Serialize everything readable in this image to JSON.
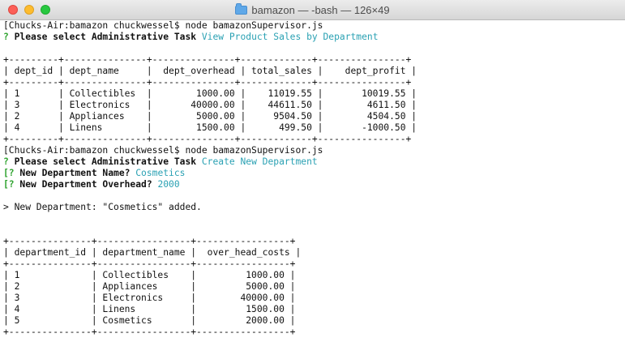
{
  "window": {
    "title": "bamazon — -bash — 126×49"
  },
  "terminal": {
    "colors": {
      "prompt_mark": "#2fa32f",
      "answer": "#2aa1b3",
      "text": "#111111"
    },
    "lines": [
      {
        "segments": [
          {
            "text": "[Chucks-Air:bamazon chuckwessel$ node bamazonSupervisor.js",
            "style": ""
          }
        ]
      },
      {
        "segments": [
          {
            "text": "? ",
            "style": "green bold"
          },
          {
            "text": "Please select Administrative Task ",
            "style": "bold"
          },
          {
            "text": "View Product Sales by Department",
            "style": "cyan"
          }
        ]
      },
      {
        "segments": []
      },
      {
        "segments": [
          {
            "text": "+---------+---------------+---------------+-------------+----------------+",
            "style": ""
          }
        ]
      },
      {
        "segments": [
          {
            "text": "| dept_id | dept_name     |  dept_overhead | total_sales |    dept_profit |",
            "style": ""
          }
        ]
      },
      {
        "segments": [
          {
            "text": "+---------+---------------+---------------+-------------+----------------+",
            "style": ""
          }
        ]
      },
      {
        "segments": [
          {
            "text": "| 1       | Collectibles  |        1000.00 |    11019.55 |       10019.55 |",
            "style": ""
          }
        ]
      },
      {
        "segments": [
          {
            "text": "| 3       | Electronics   |       40000.00 |    44611.50 |        4611.50 |",
            "style": ""
          }
        ]
      },
      {
        "segments": [
          {
            "text": "| 2       | Appliances    |        5000.00 |     9504.50 |        4504.50 |",
            "style": ""
          }
        ]
      },
      {
        "segments": [
          {
            "text": "| 4       | Linens        |        1500.00 |      499.50 |       -1000.50 |",
            "style": ""
          }
        ]
      },
      {
        "segments": [
          {
            "text": "+---------+---------------+---------------+-------------+----------------+",
            "style": ""
          }
        ]
      },
      {
        "segments": [
          {
            "text": "[Chucks-Air:bamazon chuckwessel$ node bamazonSupervisor.js",
            "style": ""
          }
        ]
      },
      {
        "segments": [
          {
            "text": "? ",
            "style": "green bold"
          },
          {
            "text": "Please select Administrative Task ",
            "style": "bold"
          },
          {
            "text": "Create New Department",
            "style": "cyan"
          }
        ]
      },
      {
        "segments": [
          {
            "text": "[? ",
            "style": "green bold"
          },
          {
            "text": "New Department Name? ",
            "style": "bold"
          },
          {
            "text": "Cosmetics",
            "style": "cyan"
          }
        ]
      },
      {
        "segments": [
          {
            "text": "[? ",
            "style": "green bold"
          },
          {
            "text": "New Department Overhead? ",
            "style": "bold"
          },
          {
            "text": "2000",
            "style": "cyan"
          }
        ]
      },
      {
        "segments": []
      },
      {
        "segments": [
          {
            "text": "> New Department: \"Cosmetics\" added.",
            "style": ""
          }
        ]
      },
      {
        "segments": []
      },
      {
        "segments": []
      },
      {
        "segments": [
          {
            "text": "+---------------+-----------------+-----------------+",
            "style": ""
          }
        ]
      },
      {
        "segments": [
          {
            "text": "| department_id | department_name |  over_head_costs |",
            "style": ""
          }
        ]
      },
      {
        "segments": [
          {
            "text": "+---------------+-----------------+-----------------+",
            "style": ""
          }
        ]
      },
      {
        "segments": [
          {
            "text": "| 1             | Collectibles    |         1000.00 |",
            "style": ""
          }
        ]
      },
      {
        "segments": [
          {
            "text": "| 2             | Appliances      |         5000.00 |",
            "style": ""
          }
        ]
      },
      {
        "segments": [
          {
            "text": "| 3             | Electronics     |        40000.00 |",
            "style": ""
          }
        ]
      },
      {
        "segments": [
          {
            "text": "| 4             | Linens          |         1500.00 |",
            "style": ""
          }
        ]
      },
      {
        "segments": [
          {
            "text": "| 5             | Cosmetics       |         2000.00 |",
            "style": ""
          }
        ]
      },
      {
        "segments": [
          {
            "text": "+---------------+-----------------+-----------------+",
            "style": ""
          }
        ]
      }
    ]
  }
}
